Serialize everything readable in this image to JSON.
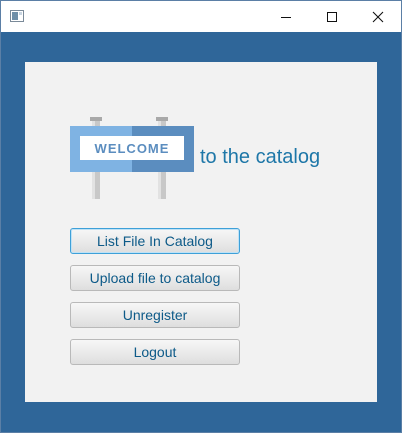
{
  "window": {
    "title": "",
    "controls": {
      "minimize_icon": "minimize-icon",
      "maximize_icon": "maximize-icon",
      "close_icon": "close-icon"
    }
  },
  "colors": {
    "frame_background": "#2f6699",
    "panel_background": "#f2f2f2",
    "accent_text": "#1e77a8",
    "button_text": "#0d5a88"
  },
  "main": {
    "sign_text": "WELCOME",
    "heading_suffix": "to the catalog",
    "buttons": {
      "list_file": "List File In Catalog",
      "upload_file": "Upload file to catalog",
      "unregister": "Unregister",
      "logout": "Logout"
    }
  }
}
